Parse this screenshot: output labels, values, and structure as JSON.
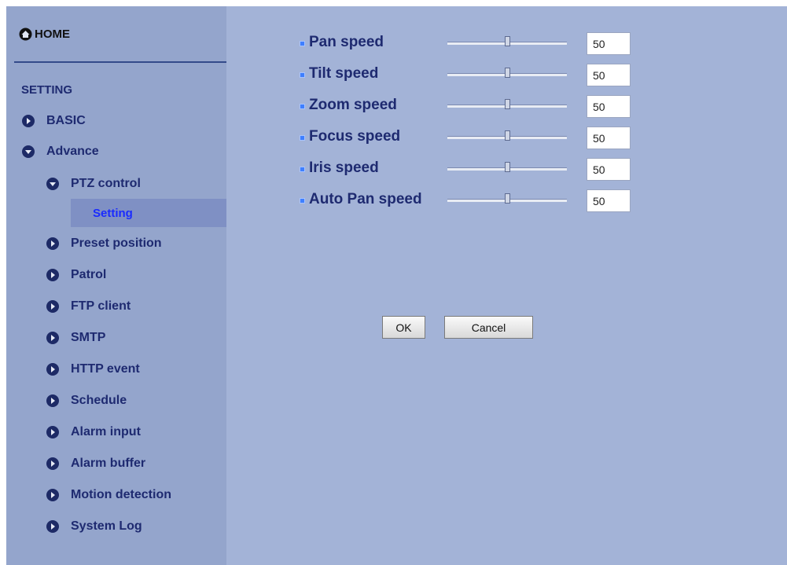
{
  "sidebar": {
    "home_label": "HOME",
    "setting_label": "SETTING",
    "items": [
      {
        "label": "BASIC"
      },
      {
        "label": "Advance"
      },
      {
        "label": "PTZ control"
      },
      {
        "label": "Preset position"
      },
      {
        "label": "Patrol"
      },
      {
        "label": "FTP client"
      },
      {
        "label": "SMTP"
      },
      {
        "label": "HTTP event"
      },
      {
        "label": "Schedule"
      },
      {
        "label": "Alarm input"
      },
      {
        "label": "Alarm buffer"
      },
      {
        "label": "Motion detection"
      },
      {
        "label": "System Log"
      }
    ],
    "current_item": "Setting"
  },
  "settings": [
    {
      "label": "Pan speed",
      "value": "50",
      "level": 0.5
    },
    {
      "label": "Tilt speed",
      "value": "50",
      "level": 0.5
    },
    {
      "label": "Zoom speed",
      "value": "50",
      "level": 0.5
    },
    {
      "label": "Focus speed",
      "value": "50",
      "level": 0.5
    },
    {
      "label": "Iris speed",
      "value": "50",
      "level": 0.5
    },
    {
      "label": "Auto Pan speed",
      "value": "50",
      "level": 0.5
    }
  ],
  "buttons": {
    "ok_label": "OK",
    "cancel_label": "Cancel"
  },
  "colors": {
    "page_background": "#a3b3d7",
    "sidebar_background": "#94a5cc",
    "nav_text": "#1e2a70",
    "current_item_text": "#1a2bff"
  }
}
